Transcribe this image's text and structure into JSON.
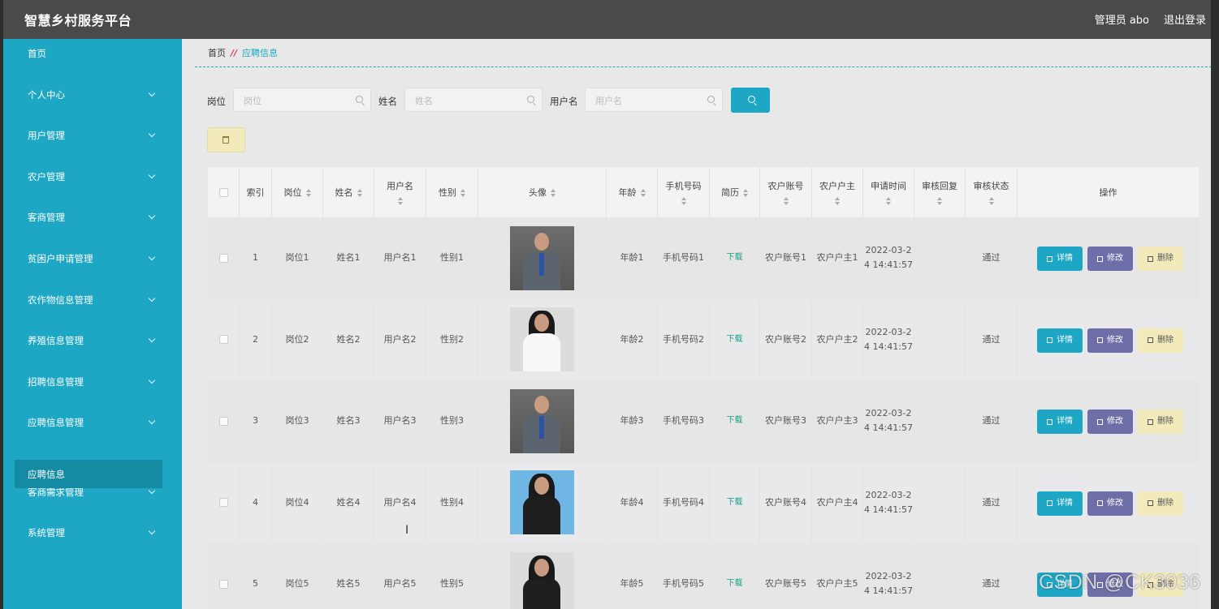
{
  "header": {
    "title": "智慧乡村服务平台",
    "user": "管理员 abo",
    "logout": "退出登录"
  },
  "sidebar": {
    "items": [
      {
        "label": "首页",
        "chevron": false
      },
      {
        "label": "个人中心",
        "chevron": true
      },
      {
        "label": "用户管理",
        "chevron": true
      },
      {
        "label": "农户管理",
        "chevron": true
      },
      {
        "label": "客商管理",
        "chevron": true
      },
      {
        "label": "贫困户申请管理",
        "chevron": true
      },
      {
        "label": "农作物信息管理",
        "chevron": true
      },
      {
        "label": "养殖信息管理",
        "chevron": true
      },
      {
        "label": "招聘信息管理",
        "chevron": true
      },
      {
        "label": "应聘信息管理",
        "chevron": true
      },
      {
        "label": "客商需求管理",
        "chevron": true
      },
      {
        "label": "系统管理",
        "chevron": true
      }
    ],
    "active_sub": "应聘信息"
  },
  "breadcrumb": {
    "home": "首页",
    "separator": "//",
    "current": "应聘信息"
  },
  "search": {
    "fields": [
      {
        "label": "岗位",
        "placeholder": "岗位",
        "value": ""
      },
      {
        "label": "姓名",
        "placeholder": "姓名",
        "value": ""
      },
      {
        "label": "用户名",
        "placeholder": "用户名",
        "value": ""
      }
    ]
  },
  "table": {
    "columns": [
      "索引",
      "岗位",
      "姓名",
      "用户名",
      "性别",
      "头像",
      "年龄",
      "手机号码",
      "简历",
      "农户账号",
      "农户户主",
      "申请时间",
      "审核回复",
      "审核状态",
      "操作"
    ],
    "rows": [
      {
        "index": "1",
        "post": "岗位1",
        "name": "姓名1",
        "username": "用户名1",
        "gender": "性别1",
        "age": "年龄1",
        "phone": "手机号码1",
        "resume": "下载",
        "account": "农户账号1",
        "owner": "农户户主1",
        "time": "2022-03-24 14:41:57",
        "reply": "",
        "status": "通过"
      },
      {
        "index": "2",
        "post": "岗位2",
        "name": "姓名2",
        "username": "用户名2",
        "gender": "性别2",
        "age": "年龄2",
        "phone": "手机号码2",
        "resume": "下载",
        "account": "农户账号2",
        "owner": "农户户主2",
        "time": "2022-03-24 14:41:57",
        "reply": "",
        "status": "通过"
      },
      {
        "index": "3",
        "post": "岗位3",
        "name": "姓名3",
        "username": "用户名3",
        "gender": "性别3",
        "age": "年龄3",
        "phone": "手机号码3",
        "resume": "下载",
        "account": "农户账号3",
        "owner": "农户户主3",
        "time": "2022-03-24 14:41:57",
        "reply": "",
        "status": "通过"
      },
      {
        "index": "4",
        "post": "岗位4",
        "name": "姓名4",
        "username": "用户名4",
        "gender": "性别4",
        "age": "年龄4",
        "phone": "手机号码4",
        "resume": "下载",
        "account": "农户账号4",
        "owner": "农户户主4",
        "time": "2022-03-24 14:41:57",
        "reply": "",
        "status": "通过"
      },
      {
        "index": "5",
        "post": "岗位5",
        "name": "姓名5",
        "username": "用户名5",
        "gender": "性别5",
        "age": "年龄5",
        "phone": "手机号码5",
        "resume": "下载",
        "account": "农户账号5",
        "owner": "农户户主5",
        "time": "2022-03-24 14:41:57",
        "reply": "",
        "status": "通过"
      }
    ],
    "actions": {
      "detail": "详情",
      "edit": "修改",
      "delete": "删除"
    }
  },
  "colors": {
    "accent": "#1ea7c4",
    "header": "#4a4a4a",
    "edit": "#6e6fa8",
    "delete": "#f2eabb",
    "link": "#17a085"
  },
  "watermark": "CSDN @CK3036"
}
